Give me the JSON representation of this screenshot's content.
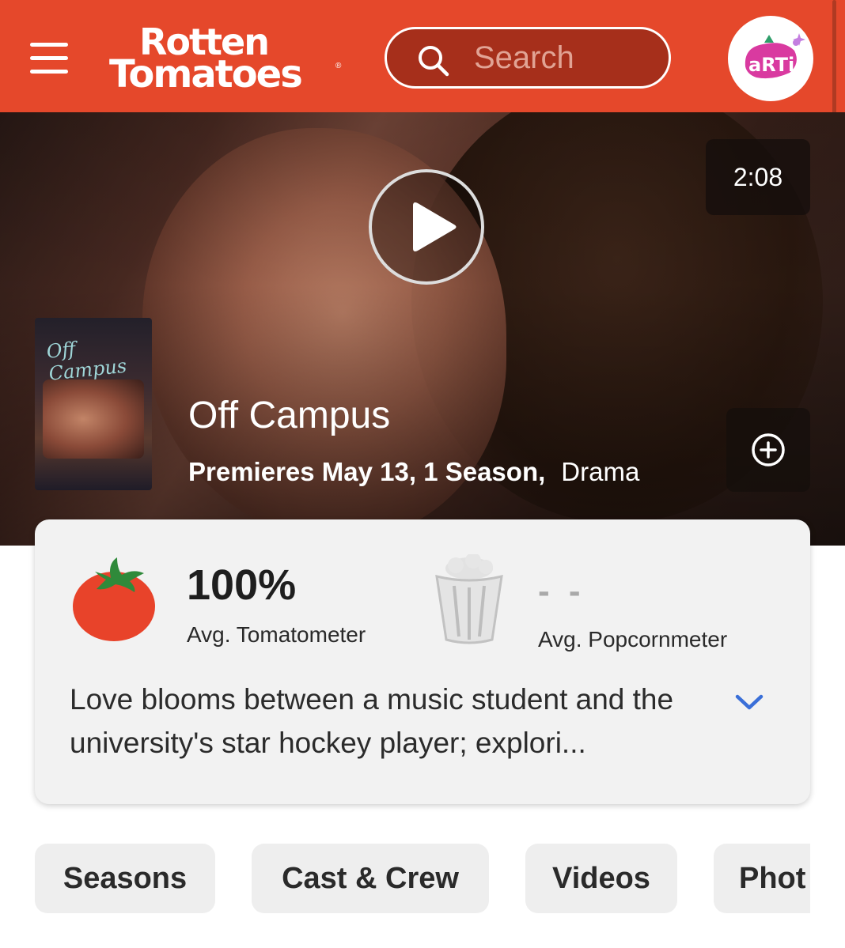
{
  "header": {
    "logo_line1": "Rotten",
    "logo_line2": "Tomatoes",
    "logo_mark": "®",
    "search_placeholder": "Search",
    "avatar_text": "aRTi",
    "background": "#e5482b"
  },
  "hero": {
    "duration": "2:08",
    "poster_title": "Off Campus",
    "title": "Off Campus",
    "meta_bold": "Premieres May 13, 1 Season,",
    "genre": "Drama"
  },
  "scores": {
    "tomatometer_value": "100%",
    "tomatometer_label": "Avg. Tomatometer",
    "popcornmeter_value": "- -",
    "popcornmeter_label": "Avg. Popcornmeter"
  },
  "synopsis": "Love blooms between a music student and the university's star hockey player; explori...",
  "tabs": [
    "Seasons",
    "Cast & Crew",
    "Videos",
    "Phot"
  ],
  "colors": {
    "accent": "#e5482b",
    "link": "#3a6fd8",
    "tomato": "#e8432a"
  }
}
